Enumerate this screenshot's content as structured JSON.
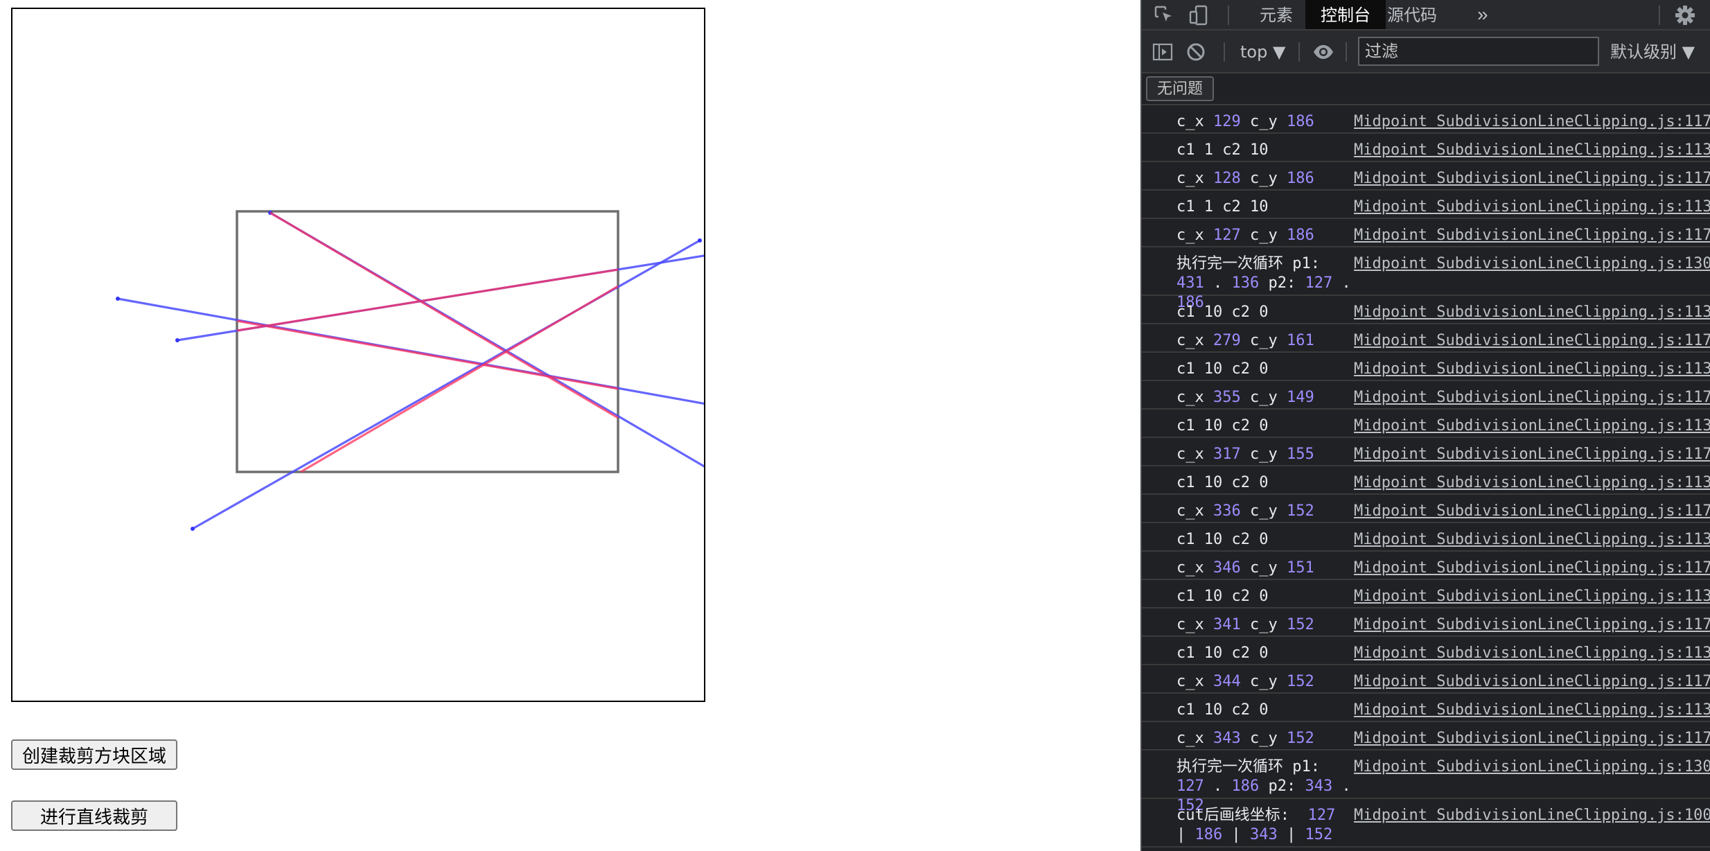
{
  "page": {
    "create_button": "创建裁剪方块区域",
    "clip_button": "进行直线裁剪",
    "clip_rect": [
      162,
      146,
      437,
      334
    ],
    "lines": [
      {
        "blue": [
          186,
          147,
          518,
          341
        ],
        "red": [
          186,
          147,
          437,
          295
        ]
      },
      {
        "blue": [
          76,
          209,
          568,
          297
        ],
        "red": [
          162,
          225,
          437,
          274
        ]
      },
      {
        "blue": [
          119,
          239,
          549,
          170
        ],
        "red": [
          162,
          232,
          437,
          188
        ]
      },
      {
        "blue": [
          130,
          375,
          496,
          167
        ],
        "red": [
          208,
          334,
          437,
          200
        ]
      }
    ]
  },
  "devtools": {
    "tabs": [
      {
        "label": "元素",
        "active": false
      },
      {
        "label": "控制台",
        "active": true
      },
      {
        "label": "源代码",
        "active": false
      }
    ],
    "more_tabs": "»",
    "context": "top ▼",
    "filter_placeholder": "过滤",
    "level": "默认级别 ▼",
    "issues": "无问题",
    "colors": {
      "number": "#9e8cff",
      "background": "#202124",
      "active_tab": "#0d0d0d"
    },
    "logs": [
      {
        "parts": [
          "c_x ",
          {
            "n": "129"
          },
          " c_y ",
          {
            "n": "186"
          }
        ],
        "src": "Midpoint SubdivisionLineClipping.js:117"
      },
      {
        "parts": [
          "c1 1 c2 10"
        ],
        "src": "Midpoint SubdivisionLineClipping.js:113"
      },
      {
        "parts": [
          "c_x ",
          {
            "n": "128"
          },
          " c_y ",
          {
            "n": "186"
          }
        ],
        "src": "Midpoint SubdivisionLineClipping.js:117"
      },
      {
        "parts": [
          "c1 1 c2 10"
        ],
        "src": "Midpoint SubdivisionLineClipping.js:113"
      },
      {
        "parts": [
          "c_x ",
          {
            "n": "127"
          },
          " c_y ",
          {
            "n": "186"
          }
        ],
        "src": "Midpoint SubdivisionLineClipping.js:117"
      },
      {
        "parts": [
          "执行完一次循环 p1:\n",
          {
            "n": "431"
          },
          " . ",
          {
            "n": "136"
          },
          " p2: ",
          {
            "n": "127"
          },
          " . ",
          {
            "n": "186"
          }
        ],
        "src": "Midpoint SubdivisionLineClipping.js:130"
      },
      {
        "parts": [
          "c1 10 c2 0"
        ],
        "src": "Midpoint SubdivisionLineClipping.js:113"
      },
      {
        "parts": [
          "c_x ",
          {
            "n": "279"
          },
          " c_y ",
          {
            "n": "161"
          }
        ],
        "src": "Midpoint SubdivisionLineClipping.js:117"
      },
      {
        "parts": [
          "c1 10 c2 0"
        ],
        "src": "Midpoint SubdivisionLineClipping.js:113"
      },
      {
        "parts": [
          "c_x ",
          {
            "n": "355"
          },
          " c_y ",
          {
            "n": "149"
          }
        ],
        "src": "Midpoint SubdivisionLineClipping.js:117"
      },
      {
        "parts": [
          "c1 10 c2 0"
        ],
        "src": "Midpoint SubdivisionLineClipping.js:113"
      },
      {
        "parts": [
          "c_x ",
          {
            "n": "317"
          },
          " c_y ",
          {
            "n": "155"
          }
        ],
        "src": "Midpoint SubdivisionLineClipping.js:117"
      },
      {
        "parts": [
          "c1 10 c2 0"
        ],
        "src": "Midpoint SubdivisionLineClipping.js:113"
      },
      {
        "parts": [
          "c_x ",
          {
            "n": "336"
          },
          " c_y ",
          {
            "n": "152"
          }
        ],
        "src": "Midpoint SubdivisionLineClipping.js:117"
      },
      {
        "parts": [
          "c1 10 c2 0"
        ],
        "src": "Midpoint SubdivisionLineClipping.js:113"
      },
      {
        "parts": [
          "c_x ",
          {
            "n": "346"
          },
          " c_y ",
          {
            "n": "151"
          }
        ],
        "src": "Midpoint SubdivisionLineClipping.js:117"
      },
      {
        "parts": [
          "c1 10 c2 0"
        ],
        "src": "Midpoint SubdivisionLineClipping.js:113"
      },
      {
        "parts": [
          "c_x ",
          {
            "n": "341"
          },
          " c_y ",
          {
            "n": "152"
          }
        ],
        "src": "Midpoint SubdivisionLineClipping.js:117"
      },
      {
        "parts": [
          "c1 10 c2 0"
        ],
        "src": "Midpoint SubdivisionLineClipping.js:113"
      },
      {
        "parts": [
          "c_x ",
          {
            "n": "344"
          },
          " c_y ",
          {
            "n": "152"
          }
        ],
        "src": "Midpoint SubdivisionLineClipping.js:117"
      },
      {
        "parts": [
          "c1 10 c2 0"
        ],
        "src": "Midpoint SubdivisionLineClipping.js:113"
      },
      {
        "parts": [
          "c_x ",
          {
            "n": "343"
          },
          " c_y ",
          {
            "n": "152"
          }
        ],
        "src": "Midpoint SubdivisionLineClipping.js:117"
      },
      {
        "parts": [
          "执行完一次循环 p1:\n",
          {
            "n": "127"
          },
          " . ",
          {
            "n": "186"
          },
          " p2: ",
          {
            "n": "343"
          },
          " . ",
          {
            "n": "152"
          }
        ],
        "src": "Midpoint SubdivisionLineClipping.js:130"
      },
      {
        "parts": [
          "cut后画线坐标:  ",
          {
            "n": "127"
          },
          "\n| ",
          {
            "n": "186"
          },
          " | ",
          {
            "n": "343"
          },
          " | ",
          {
            "n": "152"
          }
        ],
        "src": "Midpoint SubdivisionLineClipping.js:100"
      }
    ]
  }
}
